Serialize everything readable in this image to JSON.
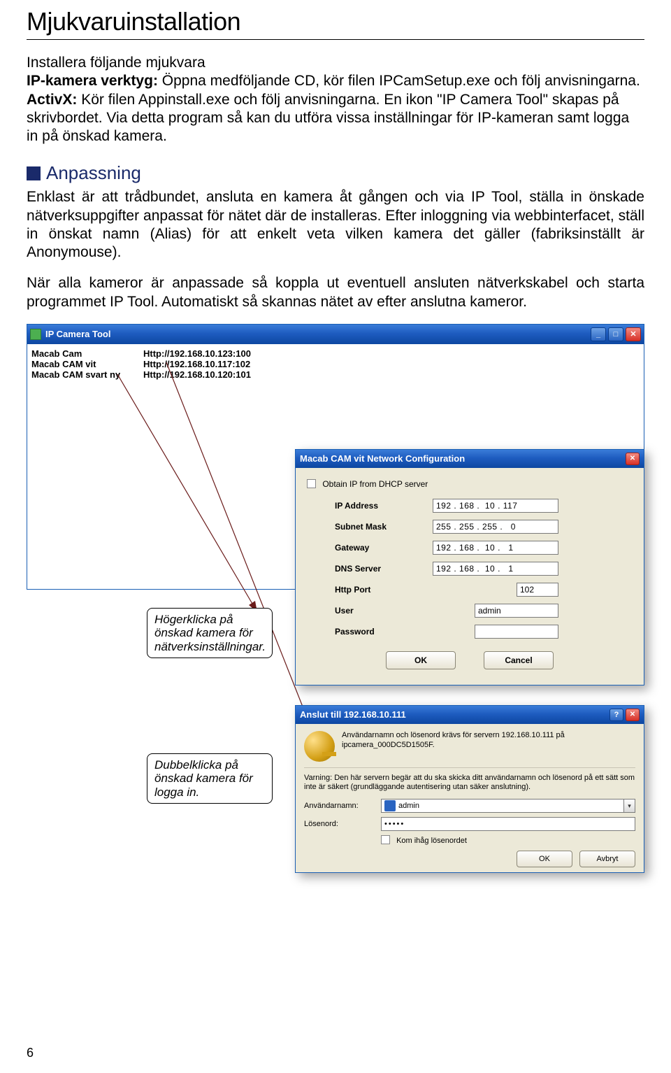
{
  "page_number": "6",
  "title": "Mjukvaruinstallation",
  "intro": {
    "line1": "Installera följande mjukvara",
    "tool_label": "IP-kamera verktyg:",
    "tool_text": " Öppna medföljande CD, kör filen IPCamSetup.exe och följ anvisningarna.",
    "activx_label": "ActivX:",
    "activx_text": " Kör filen Appinstall.exe och följ anvisningarna. En ikon \"IP Camera Tool\" skapas på skrivbordet. Via detta program så kan du utföra vissa inställningar för IP-kameran samt logga in på önskad kamera."
  },
  "section_heading": "Anpassning",
  "para1": "Enklast är att trådbundet, ansluta en kamera åt gången och via IP Tool, ställa in önskade nätverksuppgifter anpassat för nätet där de installeras. Efter inloggning via webbinterfacet, ställ in önskat namn (Alias) för att enkelt veta vilken kamera det gäller (fabriksinställt är Anonymouse).",
  "para2": "När alla kameror är anpassade så koppla ut eventuell ansluten nätverkskabel och starta programmet IP Tool. Automatiskt så skannas nätet av efter anslutna kameror.",
  "tool_window": {
    "title": "IP Camera Tool",
    "rows": [
      {
        "name": "Macab Cam",
        "url": "Http://192.168.10.123:100"
      },
      {
        "name": "Macab CAM vit",
        "url": "Http://192.168.10.117:102"
      },
      {
        "name": "Macab CAM svart ny",
        "url": "Http://192.168.10.120:101"
      }
    ]
  },
  "callout1": "Högerklicka på önskad kamera för nätverksinställningar.",
  "callout2": "Dubbelklicka på önskad kamera för logga in.",
  "netcfg": {
    "title": "Macab CAM vit Network Configuration",
    "dhcp": "Obtain IP from DHCP server",
    "labels": {
      "ip": "IP Address",
      "mask": "Subnet Mask",
      "gw": "Gateway",
      "dns": "DNS Server",
      "port": "Http Port",
      "user": "User",
      "pass": "Password"
    },
    "values": {
      "ip": "192 . 168 .  10 . 117",
      "mask": "255 . 255 . 255 .   0",
      "gw": "192 . 168 .  10 .   1",
      "dns": "192 . 168 .  10 .   1",
      "port": "102",
      "user": "admin",
      "pass": ""
    },
    "ok": "OK",
    "cancel": "Cancel"
  },
  "auth": {
    "title": "Anslut till 192.168.10.111",
    "msg": "Användarnamn och lösenord krävs för servern 192.168.10.111 på ipcamera_000DC5D1505F.",
    "warn": "Varning: Den här servern begär att du ska skicka ditt användarnamn och lösenord på ett sätt som inte är säkert (grundläggande autentisering utan säker anslutning).",
    "user_label": "Användarnamn:",
    "user_value": "admin",
    "pass_label": "Lösenord:",
    "pass_value": "•••••",
    "remember": "Kom ihåg lösenordet",
    "ok": "OK",
    "cancel": "Avbryt"
  }
}
